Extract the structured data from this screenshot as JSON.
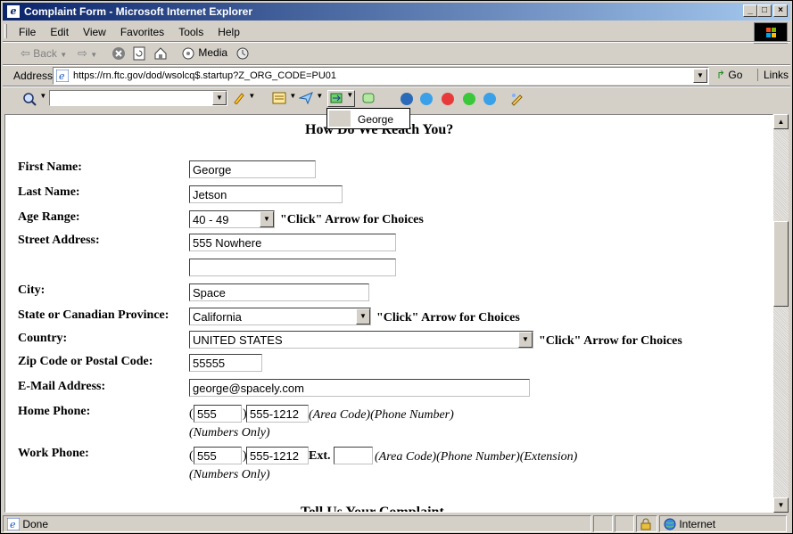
{
  "window": {
    "title": "Complaint Form - Microsoft Internet Explorer",
    "minimize": "_",
    "maximize": "□",
    "close": "×"
  },
  "menu": [
    "File",
    "Edit",
    "View",
    "Favorites",
    "Tools",
    "Help"
  ],
  "toolbar": {
    "back_label": "Back",
    "media_label": "Media"
  },
  "address": {
    "label": "Address",
    "url": "https://rn.ftc.gov/dod/wsolcq$.startup?Z_ORG_CODE=PU01",
    "go_label": "Go",
    "links_label": "Links"
  },
  "autocomplete": {
    "suggestion": "George"
  },
  "form": {
    "section_title": "How Do We Reach You?",
    "next_section_title": "Tell Us Your Complaint",
    "choices_hint": "\"Click\" Arrow for Choices",
    "first_name": {
      "label": "First Name:",
      "value": "George"
    },
    "last_name": {
      "label": "Last Name:",
      "value": "Jetson"
    },
    "age_range": {
      "label": "Age Range:",
      "value": "40 - 49"
    },
    "street": {
      "label": "Street Address:",
      "value": "555 Nowhere",
      "value2": ""
    },
    "city": {
      "label": "City:",
      "value": "Space"
    },
    "state": {
      "label": "State or Canadian Province:",
      "value": "California"
    },
    "country": {
      "label": "Country:",
      "value": "UNITED STATES"
    },
    "zip": {
      "label": "Zip Code or Postal Code:",
      "value": "55555"
    },
    "email": {
      "label": "E-Mail Address:",
      "value": "george@spacely.com"
    },
    "home_phone": {
      "label": "Home Phone:",
      "area": "555",
      "number": "555-1212",
      "hint": "(Area Code)(Phone Number)",
      "numbers_only": "(Numbers Only)"
    },
    "work_phone": {
      "label": "Work Phone:",
      "area": "555",
      "number": "555-1212",
      "ext_label": "Ext.",
      "ext": "",
      "hint": "(Area Code)(Phone Number)(Extension)",
      "numbers_only": "(Numbers Only)"
    }
  },
  "status": {
    "text": "Done",
    "zone": "Internet"
  }
}
